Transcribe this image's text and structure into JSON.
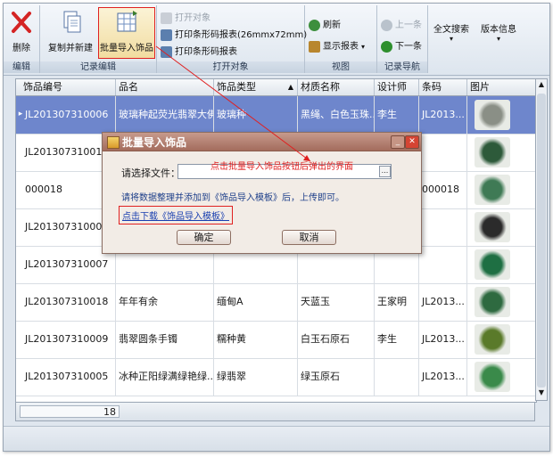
{
  "ribbon": {
    "groups": {
      "edit": "编辑",
      "record_edit": "记录编辑",
      "print": "打开对象",
      "view": "视图",
      "nav": "记录导航"
    },
    "buttons": {
      "delete": "删除",
      "copy_new": "复制并新建",
      "batch_import": "批量导入饰品",
      "open_object": "打开对象",
      "print_barcode_report": "打印条形码报表(26mmx72mm)",
      "print_barcode": "打印条形码报表",
      "refresh": "刷新",
      "show_report": "显示报表",
      "prev": "上一条",
      "next": "下一条",
      "fulltext": "全文搜索",
      "version": "版本信息"
    }
  },
  "grid": {
    "columns": [
      "饰品编号",
      "品名",
      "饰品类型",
      "材质名称",
      "设计师",
      "条码",
      "图片"
    ],
    "rows": [
      {
        "code": "JL201307310006",
        "name": "玻璃种起荧光翡翠大佛",
        "type": "玻璃种",
        "material": "黑绳、白色玉珠...",
        "designer": "李生",
        "barcode": "JL2013..."
      },
      {
        "code": "JL201307310011",
        "name": "",
        "type": "",
        "material": "",
        "designer": "",
        "barcode": ""
      },
      {
        "code": "000018",
        "name": "",
        "type": "",
        "material": "",
        "designer": "",
        "barcode": "000018"
      },
      {
        "code": "JL201307310004",
        "name": "",
        "type": "",
        "material": "",
        "designer": "",
        "barcode": ""
      },
      {
        "code": "JL201307310007",
        "name": "",
        "type": "",
        "material": "",
        "designer": "",
        "barcode": ""
      },
      {
        "code": "JL201307310018",
        "name": "年年有余",
        "type": "缅甸A",
        "material": "天蓝玉",
        "designer": "王家明",
        "barcode": "JL2013..."
      },
      {
        "code": "JL201307310009",
        "name": "翡翠圆条手镯",
        "type": "糯种黄",
        "material": "白玉石原石",
        "designer": "李生",
        "barcode": "JL2013..."
      },
      {
        "code": "JL201307310005",
        "name": "冰种正阳绿满绿艳绿...",
        "type": "绿翡翠",
        "material": "绿玉原石",
        "designer": "",
        "barcode": "JL2013..."
      }
    ],
    "record_count": "18"
  },
  "dialog": {
    "title": "批量导入饰品",
    "file_label": "请选择文件：",
    "browse": "...",
    "hint": "请将数据整理并添加到《饰品导入模板》后，上传即可。",
    "download_link": "点击下载《饰品导入模板》",
    "ok": "确定",
    "cancel": "取消"
  },
  "annotation": "点击批量导入饰品按钮后弹出的界面",
  "colors": {
    "selected_row": "#6e86cc",
    "annotation_red": "#e02020",
    "dialog_title": "#a36c5d"
  }
}
